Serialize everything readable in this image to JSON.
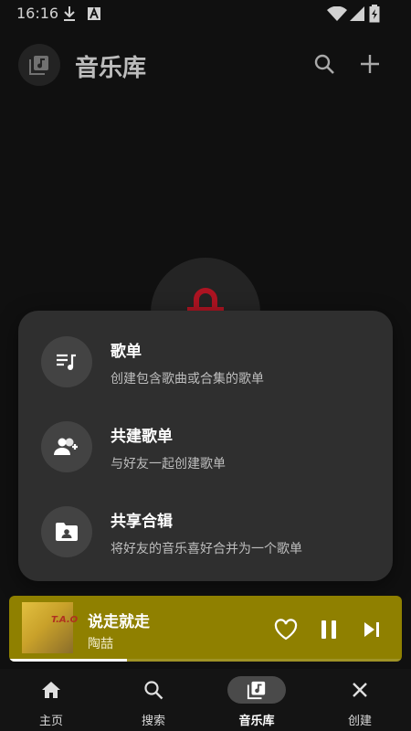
{
  "status_bar": {
    "time": "16:16",
    "icons": [
      "download-icon",
      "font-a-icon",
      "wifi-icon",
      "signal-icon",
      "battery-charging-icon"
    ]
  },
  "header": {
    "title": "音乐库",
    "icons": [
      "library-music-icon",
      "search-icon",
      "add-icon"
    ]
  },
  "sheet": {
    "items": [
      {
        "title": "歌单",
        "subtitle": "创建包含歌曲或合集的歌单",
        "icon": "playlist-icon"
      },
      {
        "title": "共建歌单",
        "subtitle": "与好友一起创建歌单",
        "icon": "add-people-icon"
      },
      {
        "title": "共享合辑",
        "subtitle": "将好友的音乐喜好合并为一个歌单",
        "icon": "shared-folder-icon"
      }
    ]
  },
  "player": {
    "title": "说走就走",
    "artist": "陶喆",
    "cover_text": "T.A.O",
    "progress": 0.3,
    "accent": "#8f8000",
    "icons": [
      "heart-icon",
      "pause-icon",
      "skip-next-icon"
    ]
  },
  "nav": {
    "items": [
      {
        "label": "主页",
        "icon": "home-icon",
        "active": false
      },
      {
        "label": "搜索",
        "icon": "search-icon",
        "active": false
      },
      {
        "label": "音乐库",
        "icon": "library-music-icon",
        "active": true
      },
      {
        "label": "创建",
        "icon": "close-icon",
        "active": false
      }
    ]
  }
}
